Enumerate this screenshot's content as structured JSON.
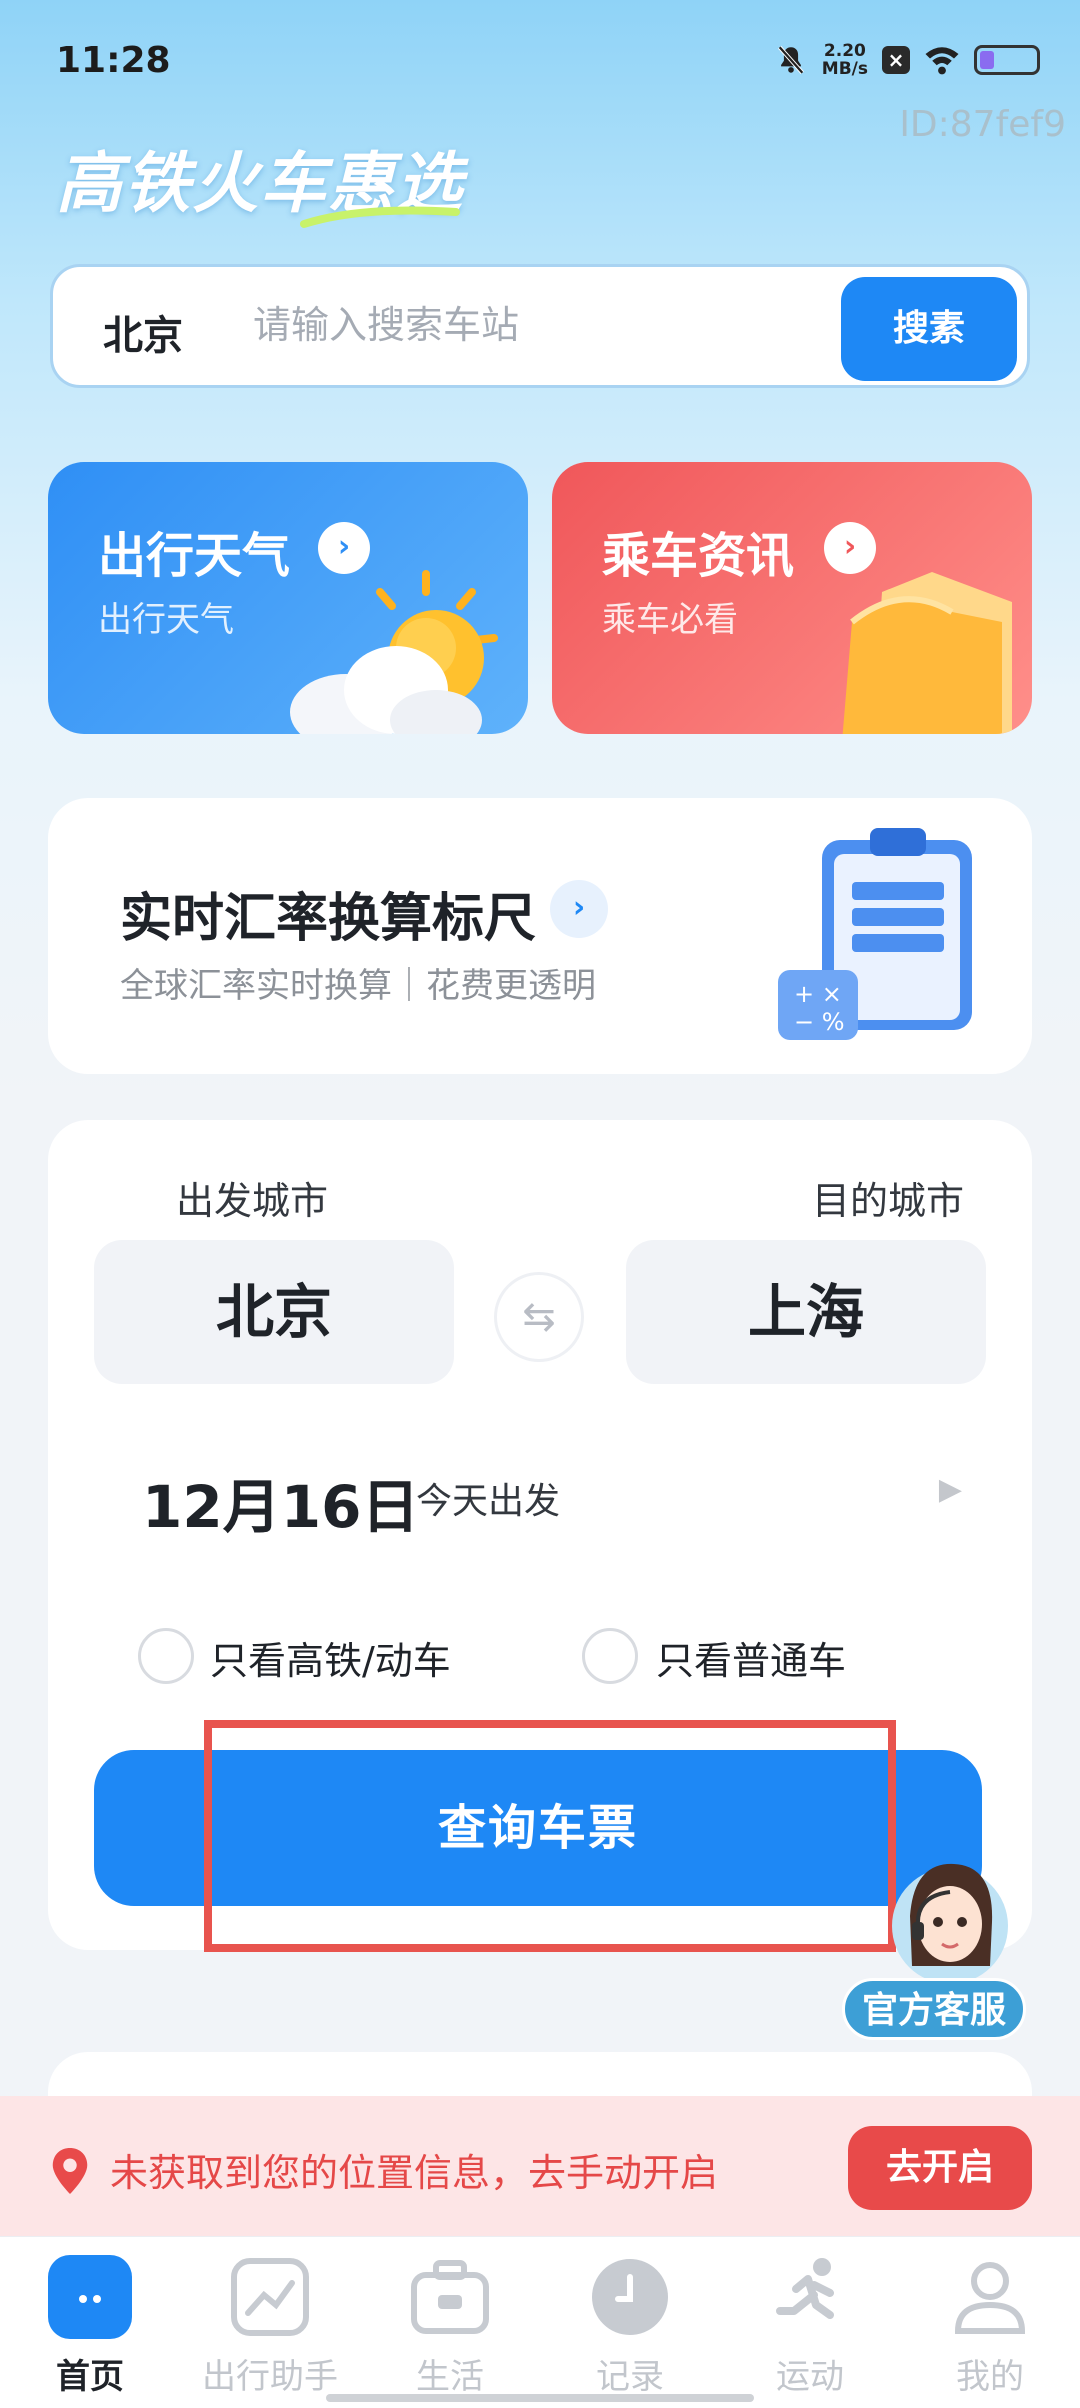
{
  "status_bar": {
    "time": "11:28",
    "speed_value": "2.20",
    "speed_unit": "MB/s",
    "battery_level": 0.26
  },
  "watermark": {
    "id_text": "ID:87fef9"
  },
  "app": {
    "title": "高铁火车惠选"
  },
  "search": {
    "city": "北京",
    "placeholder": "请输入搜索车站",
    "button_label": "搜素"
  },
  "feature_cards": {
    "weather": {
      "title": "出行天气",
      "subtitle": "出行天气"
    },
    "news": {
      "title": "乘车资讯",
      "subtitle": "乘车必看"
    }
  },
  "exchange_card": {
    "title": "实时汇率换算标尺",
    "subtitle": "全球汇率实时换算｜花费更透明"
  },
  "booking": {
    "from_label": "出发城市",
    "to_label": "目的城市",
    "from_city": "北京",
    "to_city": "上海",
    "date": "12月16日",
    "date_note": "今天出发",
    "option_highspeed": "只看高铁/动车",
    "option_normal": "只看普通车",
    "query_button": "查询车票"
  },
  "customer_service": {
    "label": "官方客服"
  },
  "location_banner": {
    "message": "未获取到您的位置信息，去手动开启",
    "button": "去开启"
  },
  "bottom_nav": {
    "items": [
      {
        "label": "首页",
        "icon": "home-icon",
        "active": true
      },
      {
        "label": "出行助手",
        "icon": "trend-chart-icon",
        "active": false
      },
      {
        "label": "生活",
        "icon": "briefcase-icon",
        "active": false
      },
      {
        "label": "记录",
        "icon": "clock-icon",
        "active": false
      },
      {
        "label": "运动",
        "icon": "running-icon",
        "active": false
      },
      {
        "label": "我的",
        "icon": "person-icon",
        "active": false
      }
    ]
  },
  "colors": {
    "primary": "#1e88f5",
    "danger": "#e84a4a",
    "weather_card": "#2f8ff5",
    "news_card": "#f0575a",
    "highlight": "#e8544e"
  }
}
